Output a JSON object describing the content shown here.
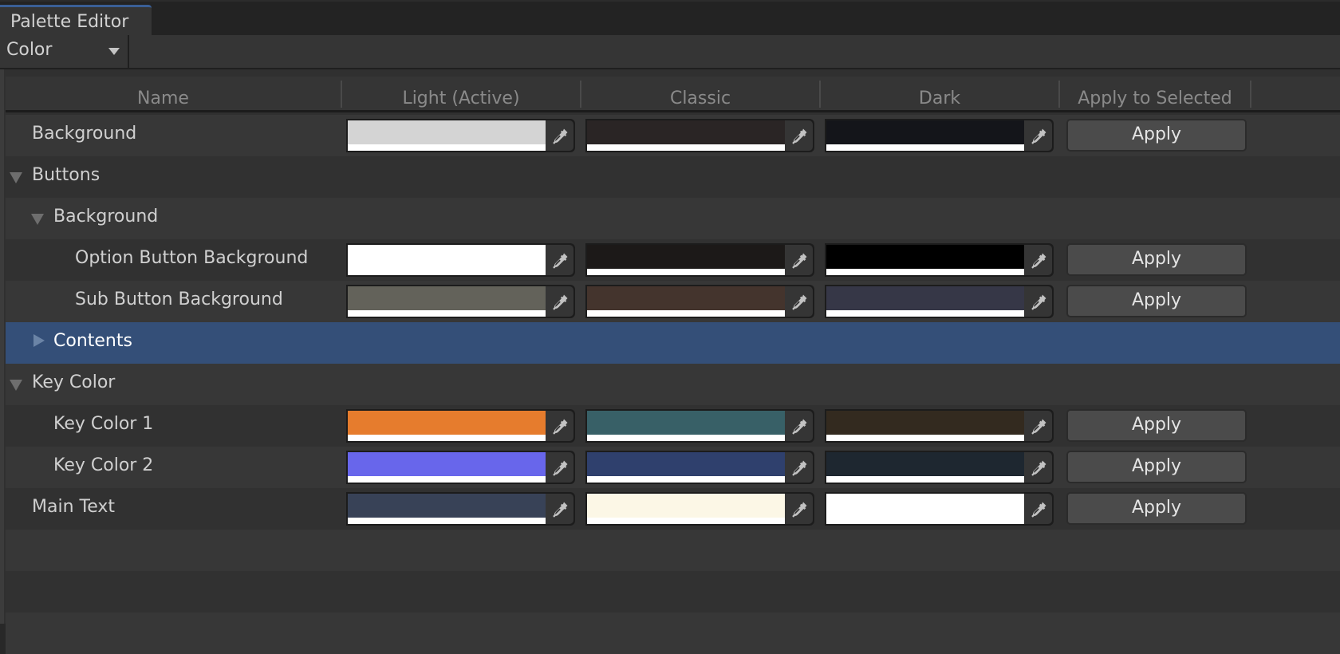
{
  "window": {
    "tab_title": "Palette Editor",
    "accent_color": "#3a5f96"
  },
  "toolbar": {
    "mode_dropdown": {
      "selected": "Color",
      "icon": "chevron-down-icon"
    }
  },
  "table": {
    "columns": [
      "Name",
      "Light (Active)",
      "Classic",
      "Dark",
      "Apply to Selected"
    ],
    "rows": [
      {
        "name": "Background",
        "kind": "color",
        "depth": 0,
        "light": "#d4d4d4",
        "classic": "#2a2525",
        "dark": "#14151a",
        "action": "Apply"
      },
      {
        "name": "Buttons",
        "kind": "group",
        "depth": 0,
        "expanded": true
      },
      {
        "name": "Background",
        "kind": "group",
        "depth": 1,
        "expanded": true
      },
      {
        "name": "Option Button Background",
        "kind": "color",
        "depth": 2,
        "light": "#ffffff",
        "classic": "#1c1918",
        "dark": "#000000",
        "action": "Apply"
      },
      {
        "name": "Sub Button Background",
        "kind": "color",
        "depth": 2,
        "light": "#63625a",
        "classic": "#44342d",
        "dark": "#363747",
        "action": "Apply"
      },
      {
        "name": "Contents",
        "kind": "group",
        "depth": 1,
        "expanded": false,
        "selected": true
      },
      {
        "name": "Key Color",
        "kind": "group",
        "depth": 0,
        "expanded": true
      },
      {
        "name": "Key Color 1",
        "kind": "color",
        "depth": 1,
        "light": "#e67c2d",
        "classic": "#386067",
        "dark": "#332a1f",
        "action": "Apply"
      },
      {
        "name": "Key Color 2",
        "kind": "color",
        "depth": 1,
        "light": "#6866eb",
        "classic": "#2f406d",
        "dark": "#1e2730",
        "action": "Apply"
      },
      {
        "name": "Main Text",
        "kind": "color",
        "depth": 0,
        "light": "#384257",
        "classic": "#fcf7e6",
        "dark": "#ffffff",
        "action": "Apply"
      }
    ]
  },
  "icons": {
    "picker": "eyedropper-icon",
    "expanded": "triangle-down-icon",
    "collapsed": "triangle-right-icon"
  }
}
